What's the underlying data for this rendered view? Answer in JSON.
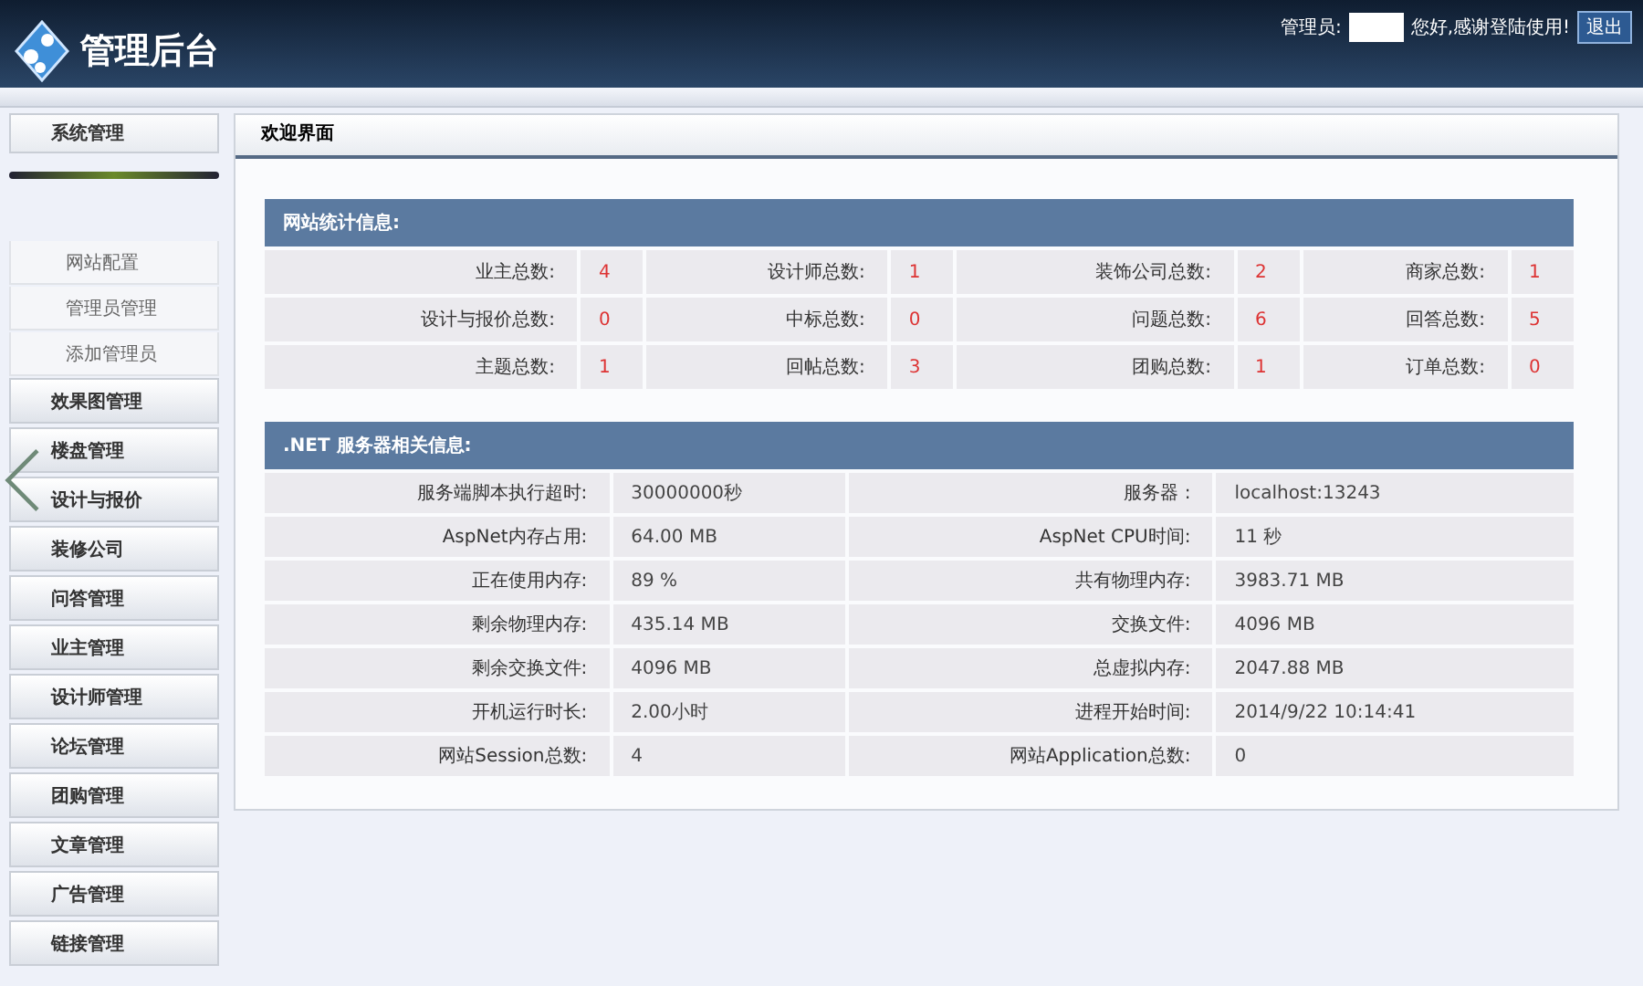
{
  "header": {
    "title": "管理后台",
    "admin_label": "管理员:",
    "greeting": "您好,感谢登陆使用!",
    "logout": "退出"
  },
  "sidebar": [
    {
      "label": "系统管理",
      "expanded": true,
      "children": [
        "网站配置",
        "管理员管理",
        "添加管理员"
      ]
    },
    {
      "label": "效果图管理",
      "expanded": false
    },
    {
      "label": "楼盘管理",
      "expanded": false
    },
    {
      "label": "设计与报价",
      "expanded": false
    },
    {
      "label": "装修公司",
      "expanded": false
    },
    {
      "label": "问答管理",
      "expanded": false
    },
    {
      "label": "业主管理",
      "expanded": false
    },
    {
      "label": "设计师管理",
      "expanded": false
    },
    {
      "label": "论坛管理",
      "expanded": false
    },
    {
      "label": "团购管理",
      "expanded": false
    },
    {
      "label": "文章管理",
      "expanded": false
    },
    {
      "label": "广告管理",
      "expanded": false
    },
    {
      "label": "链接管理",
      "expanded": false
    }
  ],
  "panel": {
    "title": "欢迎界面",
    "stats": {
      "title": "网站统计信息:",
      "rows": [
        [
          {
            "label": "业主总数:",
            "value": "4"
          },
          {
            "label": "设计师总数:",
            "value": "1"
          },
          {
            "label": "装饰公司总数:",
            "value": "2"
          },
          {
            "label": "商家总数:",
            "value": "1"
          }
        ],
        [
          {
            "label": "设计与报价总数:",
            "value": "0"
          },
          {
            "label": "中标总数:",
            "value": "0"
          },
          {
            "label": "问题总数:",
            "value": "6"
          },
          {
            "label": "回答总数:",
            "value": "5"
          }
        ],
        [
          {
            "label": "主题总数:",
            "value": "1"
          },
          {
            "label": "回帖总数:",
            "value": "3"
          },
          {
            "label": "团购总数:",
            "value": "1"
          },
          {
            "label": "订单总数:",
            "value": "0"
          }
        ]
      ]
    },
    "server": {
      "title": ".NET 服务器相关信息:",
      "rows": [
        [
          {
            "label": "服务端脚本执行超时:",
            "value": "30000000秒"
          },
          {
            "label": "服务器 :",
            "value": "localhost:13243"
          }
        ],
        [
          {
            "label": "AspNet内存占用:",
            "value": "64.00 MB"
          },
          {
            "label": "AspNet CPU时间:",
            "value": "11 秒"
          }
        ],
        [
          {
            "label": "正在使用内存:",
            "value": "89 %"
          },
          {
            "label": "共有物理内存:",
            "value": "3983.71 MB"
          }
        ],
        [
          {
            "label": "剩余物理内存:",
            "value": "435.14 MB"
          },
          {
            "label": "交换文件:",
            "value": "4096 MB"
          }
        ],
        [
          {
            "label": "剩余交换文件:",
            "value": "4096 MB"
          },
          {
            "label": "总虚拟内存:",
            "value": "2047.88 MB"
          }
        ],
        [
          {
            "label": "开机运行时长:",
            "value": "2.00小时"
          },
          {
            "label": "进程开始时间:",
            "value": "2014/9/22 10:14:41"
          }
        ],
        [
          {
            "label": "网站Session总数:",
            "value": "4"
          },
          {
            "label": "网站Application总数:",
            "value": "0"
          }
        ]
      ]
    }
  }
}
